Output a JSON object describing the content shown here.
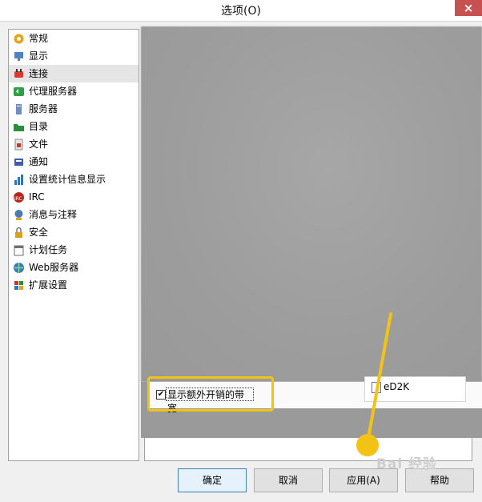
{
  "window": {
    "title": "选项(O)",
    "close_icon": "close-icon",
    "close_glyph": "×"
  },
  "sidebar": {
    "items": [
      {
        "label": "常规",
        "icon": "gear-icon",
        "color": "#e8a317",
        "selected": false
      },
      {
        "label": "显示",
        "icon": "monitor-icon",
        "color": "#4a84c4",
        "selected": false
      },
      {
        "label": "连接",
        "icon": "network-plug-icon",
        "color": "#d83b2b",
        "selected": true
      },
      {
        "label": "代理服务器",
        "icon": "proxy-icon",
        "color": "#2f9e44",
        "selected": false
      },
      {
        "label": "服务器",
        "icon": "server-icon",
        "color": "#6d8fb9",
        "selected": false
      },
      {
        "label": "目录",
        "icon": "folder-icon",
        "color": "#2a8f3a",
        "selected": false
      },
      {
        "label": "文件",
        "icon": "file-icon",
        "color": "#c43b2b",
        "selected": false
      },
      {
        "label": "通知",
        "icon": "notification-icon",
        "color": "#3d5fa8",
        "selected": false
      },
      {
        "label": "设置统计信息显示",
        "icon": "statistics-icon",
        "color": "#2b78c2",
        "selected": false
      },
      {
        "label": "IRC",
        "icon": "irc-icon",
        "color": "#b3261e",
        "selected": false
      },
      {
        "label": "消息与注释",
        "icon": "messages-icon",
        "color": "#4a7ab5",
        "selected": false
      },
      {
        "label": "安全",
        "icon": "lock-icon",
        "color": "#d9a21b",
        "selected": false
      },
      {
        "label": "计划任务",
        "icon": "calendar-icon",
        "color": "#6f6f6f",
        "selected": false
      },
      {
        "label": "Web服务器",
        "icon": "globe-icon",
        "color": "#2d7fc8",
        "selected": false
      },
      {
        "label": "扩展设置",
        "icon": "extension-icon",
        "color": "#c0392b",
        "selected": false
      }
    ]
  },
  "content": {
    "overhead_option": {
      "label": "显示额外开销的带宽",
      "checked": true,
      "check_glyph": "✔"
    },
    "ed2k_option": {
      "label": "eD2K",
      "checked": false
    }
  },
  "buttons": {
    "ok": "确定",
    "cancel": "取消",
    "apply": "应用(A)",
    "help": "帮助"
  },
  "watermark": {
    "text": "Bai 经验"
  },
  "colors": {
    "highlight": "#f2c215",
    "selected_bg": "#e5e5e5",
    "blur_gray": "#9d9d9d"
  }
}
